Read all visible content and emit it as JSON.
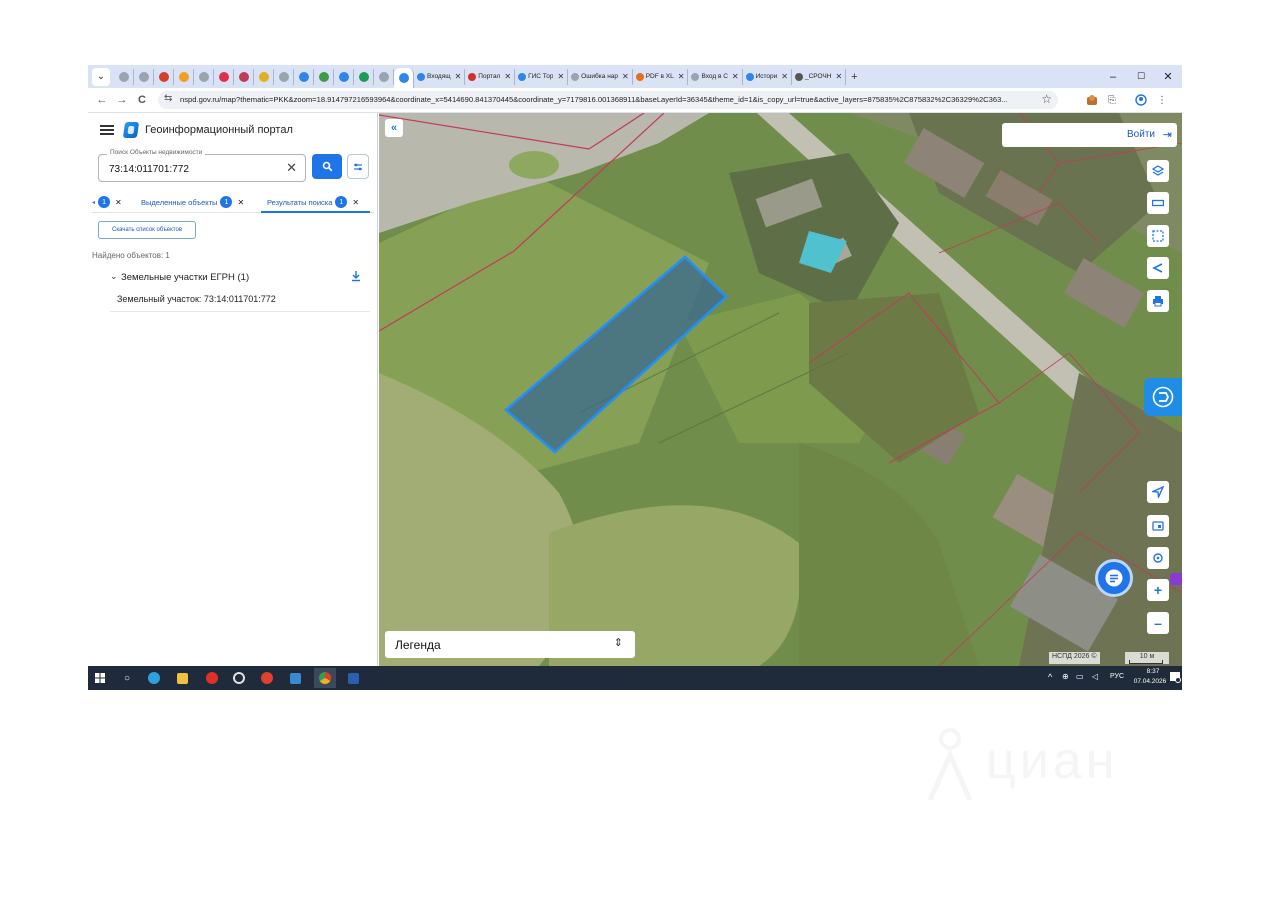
{
  "browser": {
    "pinned_tabs": [
      "#9aa3b0",
      "#9aa3b0",
      "#d4402e",
      "#f0a020",
      "#9aa3b0",
      "#e0304a",
      "#c03a5a",
      "#e0b020",
      "#9aa3b0",
      "#2f86e8",
      "#3f9a4a",
      "#2f86e8",
      "#1f9a5a",
      "#9aa3b0",
      "#2f86e8"
    ],
    "tabs": [
      {
        "label": "Входящ",
        "color": "#2f86e8"
      },
      {
        "label": "Портал",
        "color": "#d03030"
      },
      {
        "label": "ГИС Тор",
        "color": "#2f86e8"
      },
      {
        "label": "Ошибка нар",
        "color": "#9aa3b0"
      },
      {
        "label": "PDF в XL",
        "color": "#e07020"
      },
      {
        "label": "Вход в С",
        "color": "#9aa3b0"
      },
      {
        "label": "Истори",
        "color": "#2f86e8"
      },
      {
        "label": "_СРОЧН",
        "color": "#555555"
      }
    ],
    "new_tab": "+",
    "win_controls": {
      "minimize": "–",
      "maximize": "☐",
      "close": "✕"
    },
    "url": "nspd.gov.ru/map?thematic=PKK&zoom=18.914797216593964&coordinate_x=5414690.841370445&coordinate_y=7179816.001368911&baseLayerId=36345&theme_id=1&is_copy_url=true&active_layers=875835%2C875832%2C36329%2C363...",
    "nav": {
      "back": "←",
      "forward": "→",
      "reload": "C"
    }
  },
  "panel": {
    "portal_title": "Геоинформационный портал",
    "search": {
      "label": "Поиск Объекты недвижимости",
      "value": "73:14:011701:772",
      "clear": "✕"
    },
    "tabs": [
      {
        "label": "",
        "badge": "1"
      },
      {
        "label": "Выделенные объекты",
        "badge": "1"
      },
      {
        "label": "Результаты поиска",
        "badge": "1"
      }
    ],
    "download_list": "Скачать список объектов",
    "found": "Найдено объектов: 1",
    "group": {
      "chevron": "⌄",
      "title": "Земельные участки ЕГРН (1)"
    },
    "result_item": "Земельный участок: 73:14:011701:772"
  },
  "map": {
    "collapse": "«",
    "login": "Войти",
    "legend": "Легенда",
    "legend_arrows": "⌃⌄",
    "attribution": "НСПД 2026 ©",
    "scale": "10 м",
    "colors": {
      "parcel_fill": "#3a6a8f",
      "parcel_stroke": "#1f8fff",
      "boundary": "#c23a5a",
      "accent": "#1f74e8"
    },
    "controls_top": [
      "layers-icon",
      "ruler-icon",
      "select-area-icon",
      "share-icon",
      "print-icon"
    ],
    "controls_bottom": [
      "locate-icon",
      "screen-icon",
      "search-map-icon",
      "zoom-in-icon",
      "zoom-out-icon"
    ],
    "zoom_in": "+",
    "zoom_out": "–"
  },
  "taskbar": {
    "lang": "РУС",
    "time": "8:37",
    "date": "07.04.2026",
    "apps": [
      {
        "name": "start",
        "color": "#ffffff"
      },
      {
        "name": "search",
        "color": "#ffffff"
      },
      {
        "name": "edge",
        "color": "#2fa0e0"
      },
      {
        "name": "explorer",
        "color": "#f0c040"
      },
      {
        "name": "opera",
        "color": "#e0302a"
      },
      {
        "name": "app-c",
        "color": "#e0e0e0"
      },
      {
        "name": "yandex",
        "color": "#e04030"
      },
      {
        "name": "app-blue",
        "color": "#3a8ad0"
      },
      {
        "name": "chrome",
        "color": "#f0b020"
      },
      {
        "name": "word",
        "color": "#2b5fb0"
      }
    ]
  }
}
